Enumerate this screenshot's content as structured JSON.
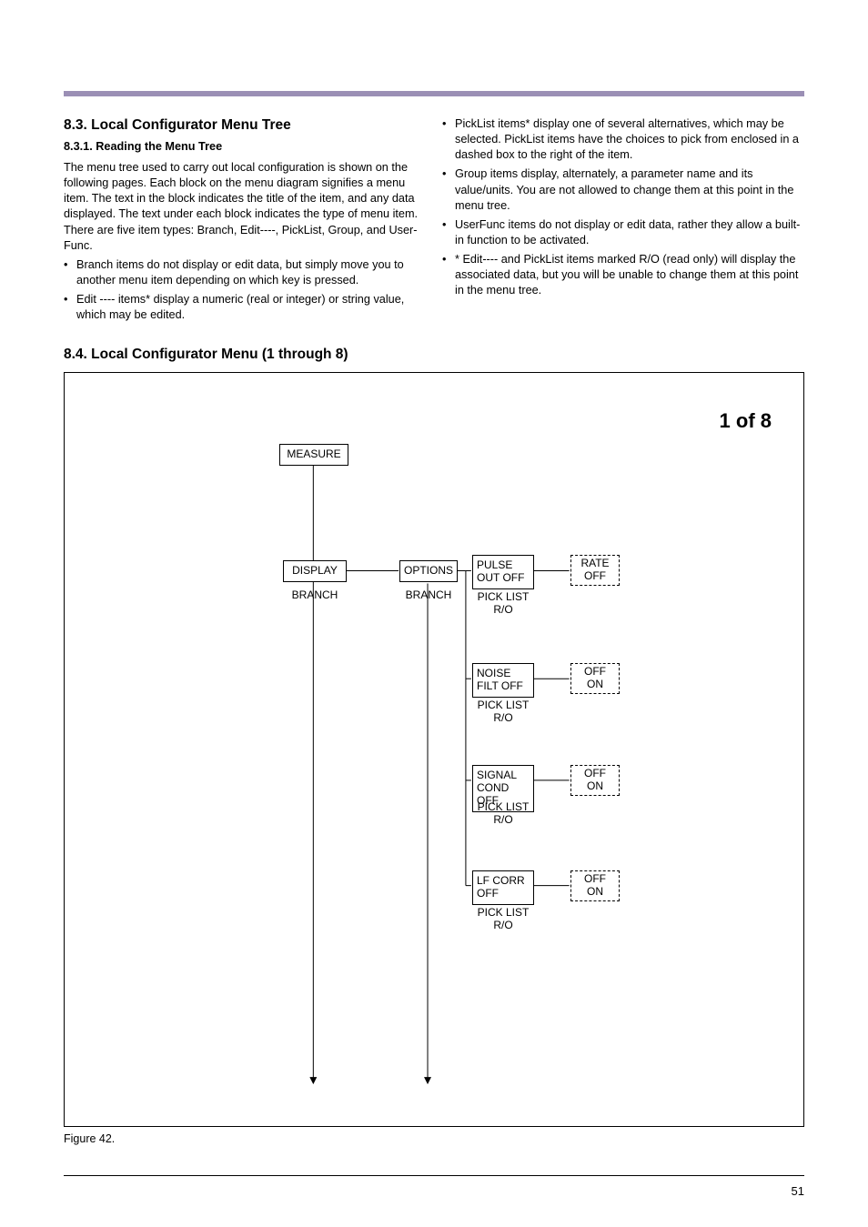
{
  "section83": {
    "heading": "8.3. Local Configurator Menu Tree",
    "subheading": "8.3.1. Reading the Menu Tree",
    "intro": "The menu tree used to carry out local configuration is shown on the following pages. Each block on the menu diagram signifies a menu item. The text in the block indicates the title of the item, and any data displayed. The text under each block indicates the type of menu item. There are five item types: Branch, Edit----, PickList, Group, and User-Func.",
    "bullets_left": [
      "Branch items do not display or edit data, but simply move you to another menu item depending on which key is pressed.",
      "Edit ---- items* display a numeric (real or integer) or string value, which may be edited."
    ],
    "bullets_right": [
      "PickList items* display one of several alternatives, which may be selected. PickList items have the choices to pick from enclosed in a dashed box to the right of the item.",
      "Group items display, alternately, a parameter name and its value/units. You are not allowed to change them at this point in the menu tree.",
      "UserFunc items do not display or edit data, rather they allow a built-in function to be activated.",
      "* Edit---- and PickList items marked R/O (read only) will display the associated data, but you will be unable to change them at this point in the menu tree."
    ]
  },
  "section84": {
    "heading": "8.4. Local Configurator Menu (1 through 8)"
  },
  "diagram": {
    "page_tag": "1 of 8",
    "nodes": {
      "measure": "MEASURE",
      "display": "DISPLAY",
      "options": "OPTIONS",
      "pulse": "PULSE\nOUT OFF",
      "noise": "NOISE\nFILT OFF",
      "signal": "SIGNAL\nCOND OFF",
      "lfcorr": "LF CORR\nOFF"
    },
    "labels": {
      "branch": "BRANCH",
      "picklist_ro": "PICK LIST\nR/O"
    },
    "dashed": {
      "rate_off": "RATE\nOFF",
      "off_on1": "OFF\nON",
      "off_on2": "OFF\nON",
      "off_on3": "OFF\nON"
    }
  },
  "caption": "Figure 42.",
  "pagenum": "51"
}
